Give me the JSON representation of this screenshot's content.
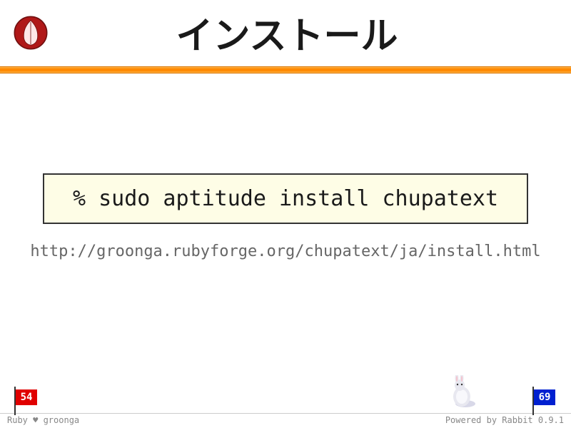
{
  "header": {
    "title": "インストール"
  },
  "content": {
    "command": "% sudo aptitude install chupatext",
    "url": "http://groonga.rubyforge.org/chupatext/ja/install.html"
  },
  "footer": {
    "flag_left": "54",
    "flag_right": "69",
    "credit_left_prefix": "Ruby ",
    "credit_left_heart": "♥",
    "credit_left_suffix": " groonga",
    "credit_right": "Powered by Rabbit 0.9.1"
  },
  "colors": {
    "accent": "#ff8800",
    "flag_current": "#e00000",
    "flag_total": "#0020d0"
  }
}
